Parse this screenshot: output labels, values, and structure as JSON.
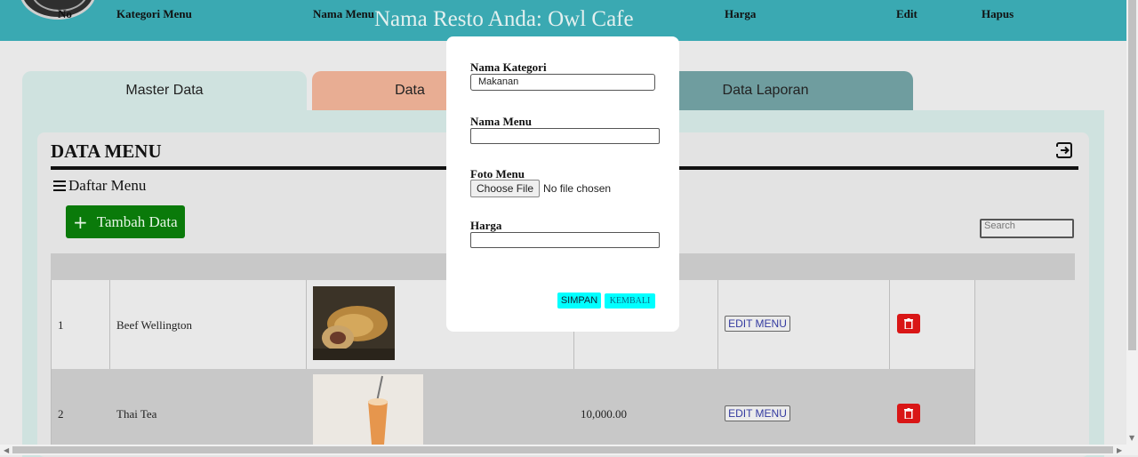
{
  "header": {
    "title": "Nama Resto Anda: Owl Cafe"
  },
  "tabs": [
    {
      "label": "Master Data"
    },
    {
      "label": "Data"
    },
    {
      "label": "Data Laporan"
    }
  ],
  "page": {
    "title": "DATA MENU",
    "list_heading": "Daftar Menu",
    "add_button": "Tambah Data",
    "search_placeholder": "Search"
  },
  "table": {
    "headers": [
      "No",
      "Kategori Menu",
      "Nama Menu",
      "Harga",
      "Edit",
      "Hapus"
    ],
    "rows": [
      {
        "no": "1",
        "kategori": "Beef Wellington",
        "harga": "",
        "edit": "EDIT MENU"
      },
      {
        "no": "2",
        "kategori": "Thai Tea",
        "harga": "10,000.00",
        "edit": "EDIT MENU"
      }
    ]
  },
  "modal": {
    "kategori_label": "Nama Kategori",
    "kategori_value": "Makanan",
    "menu_label": "Nama Menu",
    "menu_value": "",
    "foto_label": "Foto Menu",
    "file_button": "Choose File",
    "file_status": "No file chosen",
    "harga_label": "Harga",
    "harga_value": "",
    "save_button": "SIMPAN",
    "back_button": "KEMBALI"
  },
  "colors": {
    "header": "#3aa9b2",
    "add_button": "#0a7a0a",
    "delete_button": "#d91616",
    "modal_buttons": "#00ffff"
  }
}
